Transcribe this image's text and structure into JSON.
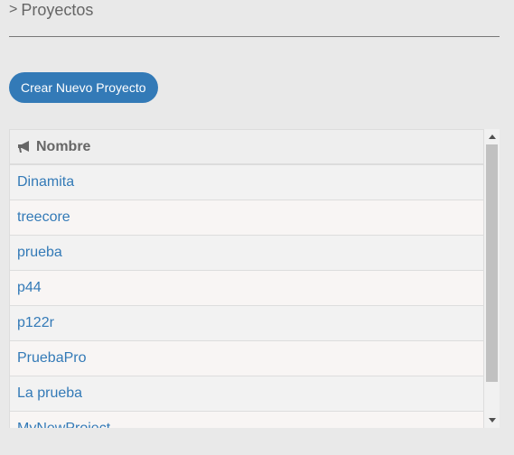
{
  "header": {
    "chevron": ">",
    "title": "Proyectos"
  },
  "actions": {
    "create_label": "Crear Nuevo Proyecto"
  },
  "table": {
    "column_name": "Nombre",
    "rows": [
      "Dinamita",
      "treecore",
      "prueba",
      "p44",
      "p122r",
      "PruebaPro",
      "La prueba",
      "MyNewProject"
    ]
  },
  "colors": {
    "accent": "#337ab7",
    "link": "#337ab7"
  },
  "icons": {
    "header_column_icon": "bullhorn-icon",
    "scroll_up": "arrow-up-icon",
    "scroll_down": "arrow-down-icon"
  }
}
